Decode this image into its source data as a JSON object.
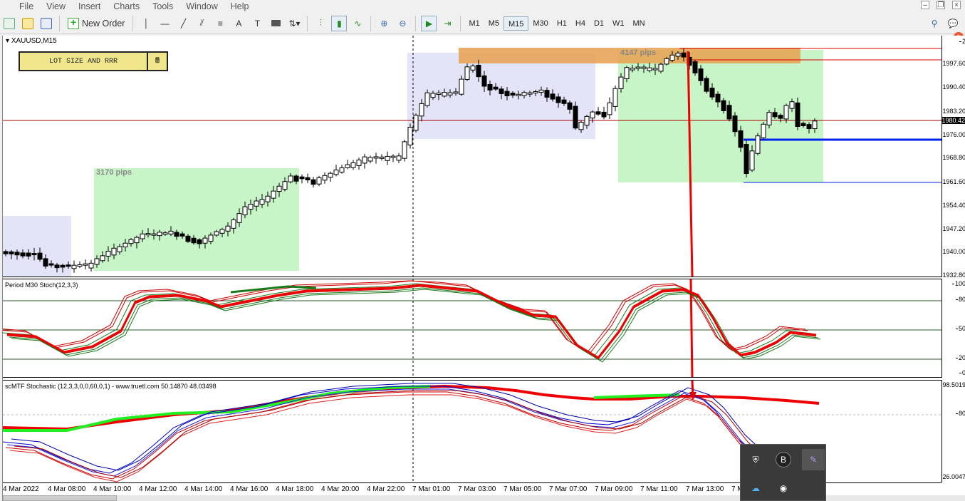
{
  "menu": [
    "File",
    "View",
    "Insert",
    "Charts",
    "Tools",
    "Window",
    "Help"
  ],
  "toolbar": {
    "new_order_label": "New Order",
    "timeframes": [
      "M1",
      "M5",
      "M15",
      "M30",
      "H1",
      "H4",
      "D1",
      "W1",
      "MN"
    ],
    "active_timeframe": "M15",
    "drawing_tools": [
      "A",
      "T"
    ]
  },
  "chart": {
    "symbol": "XAUUSD,M15",
    "lot_panel_label": "LOT SIZE AND RRR",
    "pips_1": "3170 pips",
    "pips_2": "4147 pips",
    "current_price": "1980.42",
    "price_ticks": [
      "2",
      "1997.60",
      "1990.40",
      "1983.20",
      "1976.00",
      "1968.80",
      "1961.60",
      "1954.40",
      "1947.20",
      "1940.00",
      "1932.80"
    ],
    "stoch_title": "Period M30 Stoch(12,3,3)",
    "stoch_ticks": [
      "100",
      "80",
      "50",
      "20",
      "0"
    ],
    "mtf_title": "scMTF Stochastic (12,3,3,0,0,60,0,1) - www.truetl.com 50.14870 48.03498",
    "mtf_ticks": [
      "98.5019",
      "80",
      "26.0047"
    ],
    "time_labels": [
      "4 Mar 2022",
      "4 Mar 08:00",
      "4 Mar 10:00",
      "4 Mar 12:00",
      "4 Mar 14:00",
      "4 Mar 16:00",
      "4 Mar 18:00",
      "4 Mar 20:00",
      "4 Mar 22:00",
      "7 Mar 01:00",
      "7 Mar 03:00",
      "7 Mar 05:00",
      "7 Mar 07:00",
      "7 Mar 09:00",
      "7 Mar 11:00",
      "7 Mar 13:00",
      "7 M"
    ]
  },
  "colors": {
    "bull_zone": "#c8f5c8",
    "range_zone": "#e4e4f8",
    "supply_zone": "#e8a050",
    "red_line": "#ff0000",
    "blue_line": "#0000ff",
    "green_line": "#00ee00"
  },
  "tray_icons": [
    "shield-icon",
    "bybit-icon",
    "feather-icon",
    "cloud-icon",
    "discord-icon"
  ],
  "error_badge": "1"
}
